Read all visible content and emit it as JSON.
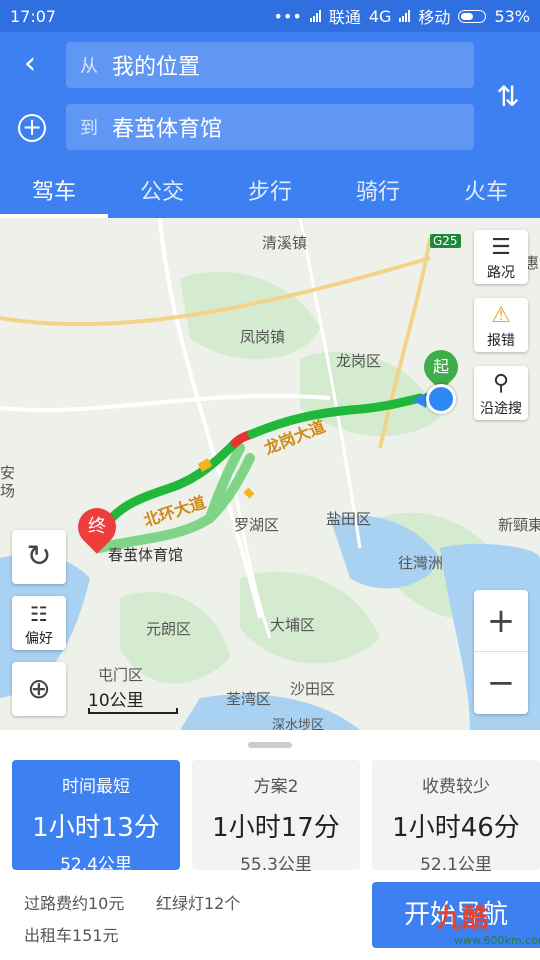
{
  "status_bar": {
    "time": "17:07",
    "dots": "•••",
    "carrier1": "联通",
    "network": "4G",
    "carrier2": "移动",
    "battery": "53%"
  },
  "header": {
    "from_prefix": "从",
    "from_value": "我的位置",
    "to_prefix": "到",
    "to_value": "春茧体育馆",
    "tabs": [
      {
        "label": "驾车",
        "active": true
      },
      {
        "label": "公交",
        "active": false
      },
      {
        "label": "步行",
        "active": false
      },
      {
        "label": "骑行",
        "active": false
      },
      {
        "label": "火车",
        "active": false
      }
    ]
  },
  "map": {
    "place_labels": {
      "qingxi": "清溪镇",
      "fenggang": "凤岗镇",
      "longgang": "龙岗区",
      "luohu": "罗湖区",
      "yantian": "盐田区",
      "yuanlang": "元朗区",
      "dapu": "大埔区",
      "tunmen": "屯门区",
      "shatian": "沙田区",
      "quanwan": "荃湾区",
      "xinyi": "新頸東",
      "zhuwan": "往灣洲",
      "shenshuibu": "深水埗区",
      "hui": "惠",
      "an": "安",
      "chang": "场"
    },
    "road_labels": {
      "beihuan": "北环大道",
      "longgang_ave": "龙岗大道"
    },
    "highway_shield": "G25",
    "tools": {
      "traffic": "路况",
      "report": "报错",
      "search_along": "沿途搜",
      "preference": "偏好"
    },
    "markers": {
      "start": "起",
      "end": "终",
      "destination_name": "春茧体育馆"
    },
    "scale_text": "10公里",
    "colors": {
      "route_clear": "#1fb83a",
      "route_jam": "#e8322e",
      "route_slow": "#f3b51a",
      "alt_route": "#7fd487",
      "accent": "#3d80f2"
    }
  },
  "plans": [
    {
      "tag": "时间最短",
      "duration": "1小时13分",
      "distance": "52.4公里",
      "selected": true
    },
    {
      "tag": "方案2",
      "duration": "1小时17分",
      "distance": "55.3公里",
      "selected": false
    },
    {
      "tag": "收费较少",
      "duration": "1小时46分",
      "distance": "52.1公里",
      "selected": false
    }
  ],
  "route_info": {
    "toll": "过路费约10元",
    "lights": "红绿灯12个",
    "taxi": "出租车151元"
  },
  "nav_button": "开始导航",
  "watermark": {
    "text": "九酷",
    "url": "www.600km.com"
  }
}
